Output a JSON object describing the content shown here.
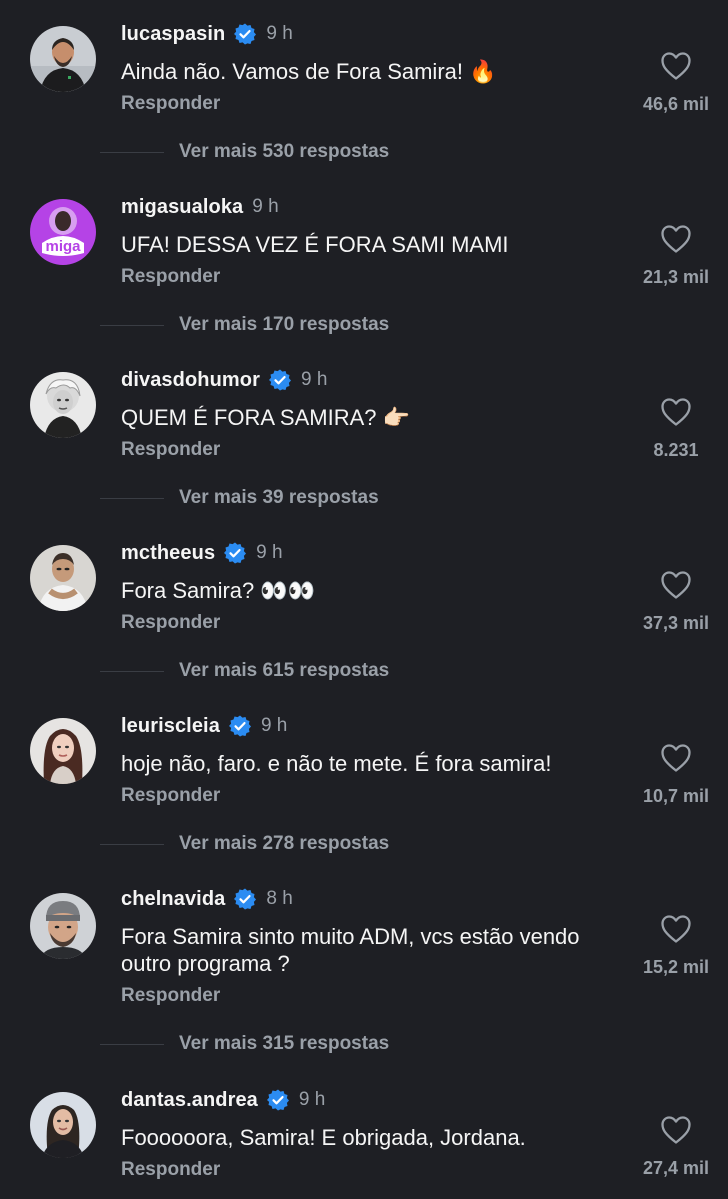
{
  "accent_verified": "#2b8cf2",
  "comments": [
    {
      "username": "lucaspasin",
      "verified": true,
      "time": "9 h",
      "text": "Ainda não. Vamos de Fora Samira! 🔥",
      "reply_label": "Responder",
      "likes": "46,6 mil",
      "more_replies": "Ver mais 530 respostas"
    },
    {
      "username": "migasualoka",
      "verified": false,
      "time": "9 h",
      "text": "UFA! DESSA VEZ É FORA SAMI MAMI",
      "reply_label": "Responder",
      "likes": "21,3 mil",
      "more_replies": "Ver mais 170 respostas",
      "avatar_text": "miga"
    },
    {
      "username": "divasdohumor",
      "verified": true,
      "time": "9 h",
      "text": "QUEM É FORA SAMIRA? 👉🏻",
      "reply_label": "Responder",
      "likes": "8.231",
      "more_replies": "Ver mais 39 respostas"
    },
    {
      "username": "mctheeus",
      "verified": true,
      "time": "9 h",
      "text": "Fora Samira? 👀👀",
      "reply_label": "Responder",
      "likes": "37,3 mil",
      "more_replies": "Ver mais 615 respostas"
    },
    {
      "username": "leuriscleia",
      "verified": true,
      "time": "9 h",
      "text": "hoje não, faro. e não te mete. É fora samira!",
      "reply_label": "Responder",
      "likes": "10,7 mil",
      "more_replies": "Ver mais 278 respostas"
    },
    {
      "username": "chelnavida",
      "verified": true,
      "time": "8 h",
      "text": "Fora Samira sinto muito ADM, vcs estão vendo outro programa ?",
      "reply_label": "Responder",
      "likes": "15,2 mil",
      "more_replies": "Ver mais 315 respostas"
    },
    {
      "username": "dantas.andrea",
      "verified": true,
      "time": "9 h",
      "text": "Foooooora, Samira! E obrigada, Jordana.",
      "reply_label": "Responder",
      "likes": "27,4 mil"
    }
  ]
}
